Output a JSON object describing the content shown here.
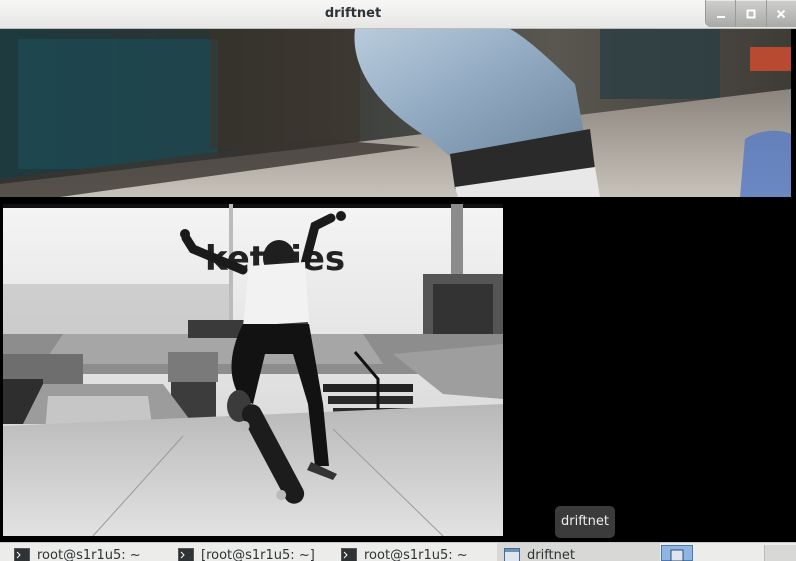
{
  "window": {
    "title": "driftnet",
    "buttons": {
      "minimize": "minimize",
      "maximize": "maximize",
      "close": "close"
    }
  },
  "images": {
    "top": {
      "alt": ""
    },
    "main": {
      "alt": "",
      "wall_text": "ketnies"
    }
  },
  "tooltip": {
    "text": "driftnet"
  },
  "taskbar": {
    "tasks": [
      {
        "label": "root@s1r1u5: ~",
        "icon": "terminal-icon"
      },
      {
        "label": "[root@s1r1u5: ~]",
        "icon": "terminal-icon"
      },
      {
        "label": "root@s1r1u5: ~",
        "icon": "terminal-icon"
      },
      {
        "label": "driftnet",
        "icon": "window-icon",
        "active": true
      }
    ]
  },
  "colors": {
    "titlebar": "#e9e9e7",
    "taskbar": "#ececea",
    "pager_active": "#8fb6e3"
  }
}
